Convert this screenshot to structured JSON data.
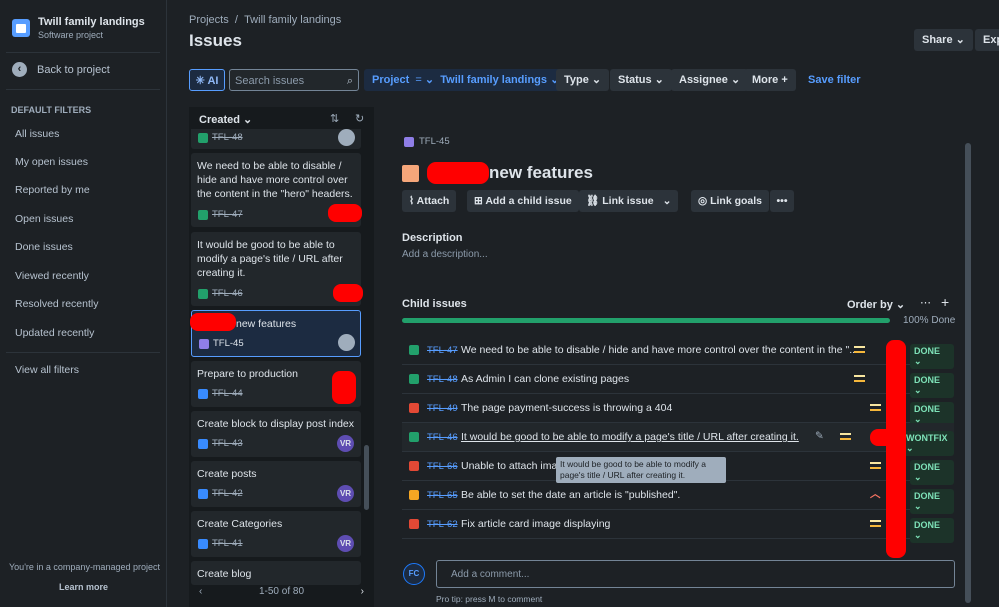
{
  "project": {
    "name": "Twill family landings",
    "type": "Software project"
  },
  "sidebar": {
    "back": "Back to project",
    "section": "DEFAULT FILTERS",
    "filters": [
      "All issues",
      "My open issues",
      "Reported by me",
      "Open issues",
      "Done issues",
      "Viewed recently",
      "Resolved recently",
      "Updated recently"
    ],
    "view_all": "View all filters",
    "footer": "You're in a company-managed project",
    "learn": "Learn more"
  },
  "header": {
    "breadcrumb_projects": "Projects",
    "breadcrumb_sep": "/",
    "breadcrumb_project": "Twill family landings",
    "title": "Issues",
    "share": "Share",
    "export": "Exp"
  },
  "filterbar": {
    "ai": "AI",
    "search_placeholder": "Search issues",
    "project_label": "Project",
    "project_op": "=",
    "project_value": "Twill family landings",
    "type": "Type",
    "status": "Status",
    "assignee": "Assignee",
    "more": "More",
    "save": "Save filter"
  },
  "list": {
    "sort": "Created",
    "pager": "1-50 of 80",
    "cards": [
      {
        "key": "TFL-48",
        "text": ""
      },
      {
        "key": "TFL-47",
        "text": "We need to be able to disable / hide and have more control over the content in the \"hero\" headers."
      },
      {
        "key": "TFL-46",
        "text": "It would be good to be able to modify a page's title / URL after creating it."
      },
      {
        "key": "TFL-45",
        "text": "new features"
      },
      {
        "key": "TFL-44",
        "text": "Prepare to production"
      },
      {
        "key": "TFL-43",
        "text": "Create block to display post index",
        "avatar": "VR"
      },
      {
        "key": "TFL-42",
        "text": "Create posts",
        "avatar": "VR"
      },
      {
        "key": "TFL-41",
        "text": "Create Categories",
        "avatar": "VR"
      },
      {
        "key": "",
        "text": "Create blog"
      }
    ]
  },
  "issue": {
    "key": "TFL-45",
    "title": "new features",
    "attach": "Attach",
    "add_child": "Add a child issue",
    "link": "Link issue",
    "goals": "Link goals",
    "desc_label": "Description",
    "desc_placeholder": "Add a description...",
    "child_label": "Child issues",
    "order": "Order by",
    "progress": 1.0,
    "progress_text": "100% Done",
    "children": [
      {
        "key": "TFL-47",
        "title": "We need to be able to disable / hide and have more control over the content in the \"...",
        "status": "DONE"
      },
      {
        "key": "TFL-48",
        "title": "As Admin I can clone existing pages",
        "status": "DONE"
      },
      {
        "key": "TFL-49",
        "title": "The page payment-success is throwing a 404",
        "status": "DONE"
      },
      {
        "key": "TFL-46",
        "title": "It would be good to be able to modify a page's title / URL after creating it.",
        "status": "WONTFIX"
      },
      {
        "key": "TFL-66",
        "title": "Unable to attach imag",
        "status": "DONE"
      },
      {
        "key": "TFL-65",
        "title": "Be able to set the date an article is \"published\".",
        "status": "DONE"
      },
      {
        "key": "TFL-62",
        "title": "Fix article card image displaying",
        "status": "DONE"
      }
    ],
    "tooltip": "It would be good to be able to modify a page's title / URL after creating it.",
    "comment_placeholder": "Add a comment...",
    "avatar": "FC",
    "protip": "Pro tip: press M to comment"
  }
}
